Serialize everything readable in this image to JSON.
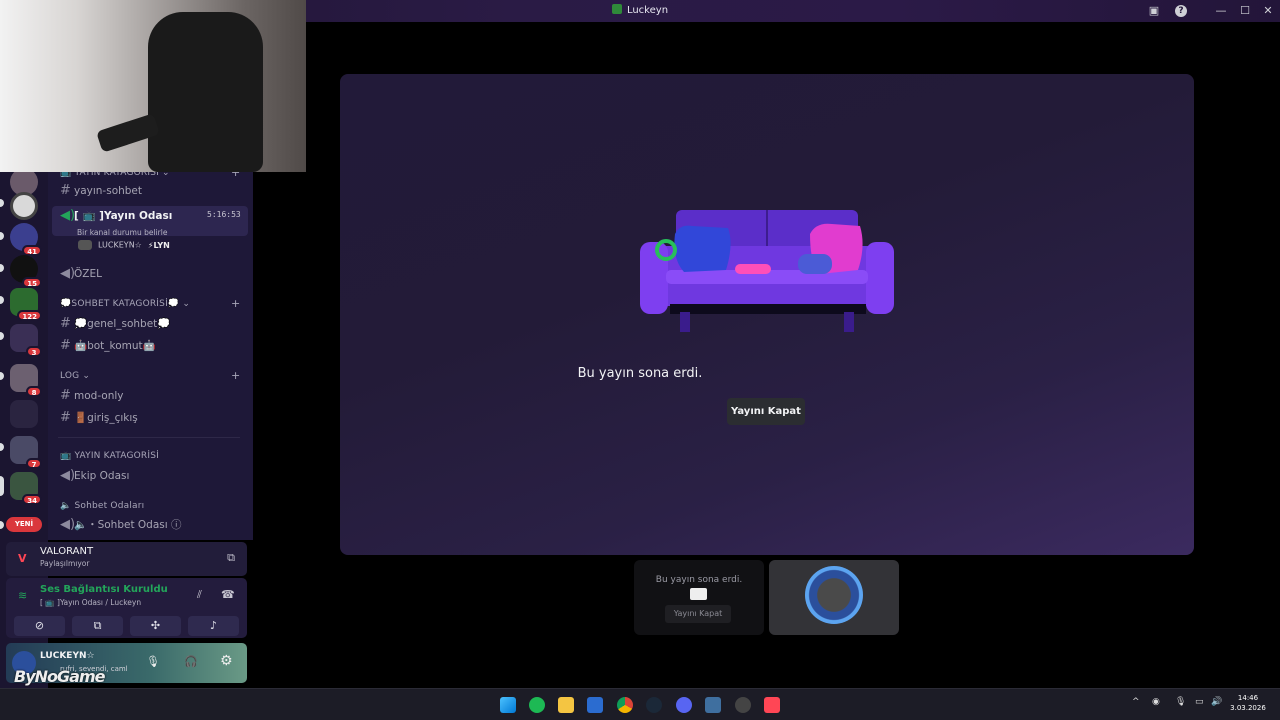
{
  "window": {
    "title": "Luckeyn"
  },
  "sidebar": {
    "categories": {
      "yayin_top": "YAYIN KATAGORİSİ",
      "sohbet": "💭SOHBET KATAGORİSİ💭",
      "log": "LOG",
      "yayin_bottom": "YAYIN KATAGORİSİ",
      "sohbet_odalari": "Sohbet Odaları"
    },
    "channels": {
      "yayin_sohbet": "yayın-sohbet",
      "yayin_odasi": "[ 📺 ]Yayın Odası",
      "yayin_odasi_status": "Bir kanal durumu belirle",
      "yayin_odasi_time": "5:16:53",
      "voice_user": "LUCKEYN☆",
      "voice_user_tag": "⚡LYN",
      "ozel": "ÖZEL",
      "genel_sohbet": "💭genel_sohbet💭",
      "bot_komut": "🤖bot_komut🤖",
      "mod_only": "mod-only",
      "giris_cikis": "🚪giriş_çıkış",
      "ekip_odasi": "Ekip Odası",
      "sohbet_odasi": "🔈・Sohbet Odası"
    },
    "guild_badges": [
      "41",
      "15",
      "122",
      "3",
      "8",
      "7",
      "34"
    ],
    "new_label": "YENİ"
  },
  "activity": {
    "game": "VALORANT",
    "status": "Paylaşılmıyor"
  },
  "voice": {
    "status": "Ses Bağlantısı Kuruldu",
    "channel": "[ 📺 ]Yayın Odası / Luckeyn"
  },
  "user": {
    "name": "LUCKEYN☆",
    "custom_status": "rufri, sevendi, caml"
  },
  "stream": {
    "ended_text": "Bu yayın sona erdi.",
    "close_label": "Yayını Kapat"
  },
  "thumbnails": {
    "ended_text": "Bu yayın sona erdi.",
    "close_label": "Yayını Kapat"
  },
  "taskbar": {
    "time": "14:46",
    "date": "3.03.2026"
  },
  "watermark": "ByNoGame",
  "colors": {
    "accent": "#5865f2",
    "voice_green": "#23a55a",
    "badge_red": "#da373c"
  }
}
